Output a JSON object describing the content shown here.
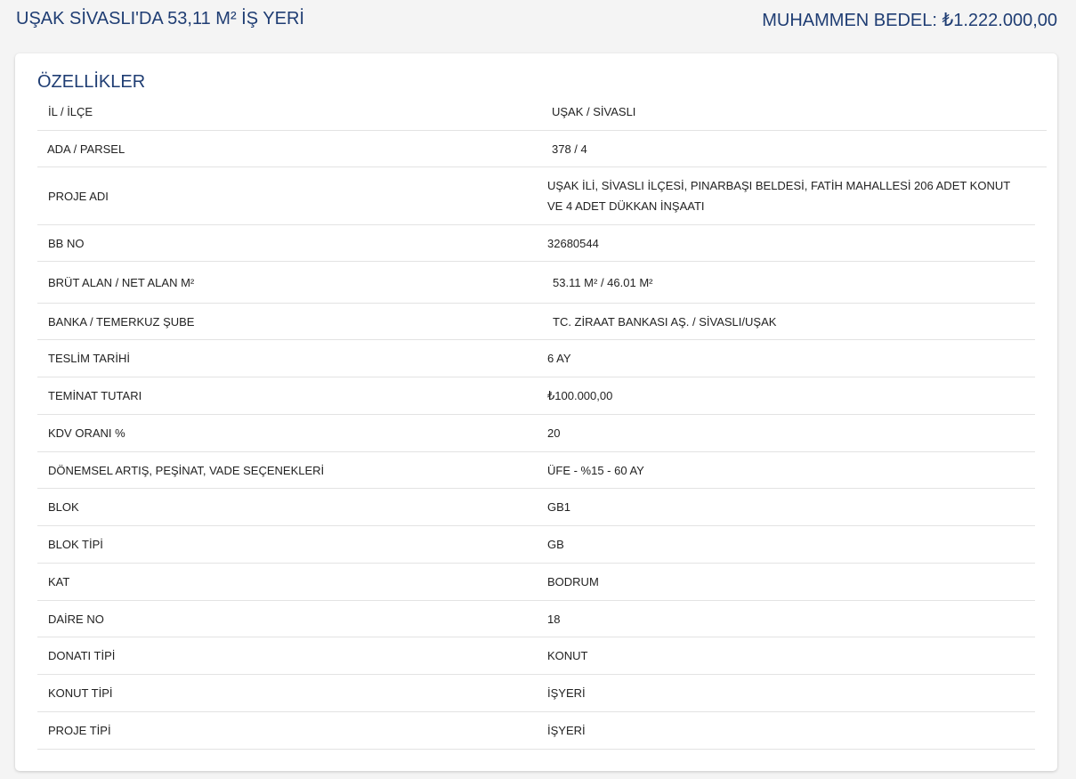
{
  "header": {
    "title": "UŞAK SİVASLI'DA 53,11 M² İŞ YERİ",
    "price": "MUHAMMEN BEDEL: ₺1.222.000,00"
  },
  "section": {
    "title": "ÖZELLİKLER"
  },
  "rows": [
    {
      "label": "İL / İLÇE",
      "value": "UŞAK / SİVASLI"
    },
    {
      "label": "ADA / PARSEL",
      "value": "378 / 4"
    },
    {
      "label": "PROJE ADI",
      "value": "UŞAK İLİ, SİVASLI İLÇESİ, PINARBAŞI BELDESİ, FATİH MAHALLESİ 206 ADET KONUT VE 4 ADET DÜKKAN İNŞAATI"
    },
    {
      "label": "BB NO",
      "value": "32680544"
    },
    {
      "label": "BRÜT ALAN / NET ALAN M²",
      "value": "53.11 M² / 46.01 M²"
    },
    {
      "label": "BANKA / TEMERKUZ ŞUBE",
      "value": "TC. ZİRAAT BANKASI AŞ. / SİVASLI/UŞAK"
    },
    {
      "label": "TESLİM TARİHİ",
      "value": "6 AY"
    },
    {
      "label": "TEMİNAT TUTARI",
      "value": "₺100.000,00"
    },
    {
      "label": "KDV ORANI %",
      "value": "20"
    },
    {
      "label": "DÖNEMSEL ARTIŞ, PEŞİNAT, VADE SEÇENEKLERİ",
      "value": "ÜFE - %15 - 60 AY"
    },
    {
      "label": "BLOK",
      "value": "GB1"
    },
    {
      "label": "BLOK TİPİ",
      "value": "GB"
    },
    {
      "label": "KAT",
      "value": "BODRUM"
    },
    {
      "label": "DAİRE NO",
      "value": "18"
    },
    {
      "label": "DONATI TİPİ",
      "value": "KONUT"
    },
    {
      "label": "KONUT TİPİ",
      "value": "İŞYERİ"
    },
    {
      "label": "PROJE TİPİ",
      "value": "İŞYERİ"
    }
  ]
}
